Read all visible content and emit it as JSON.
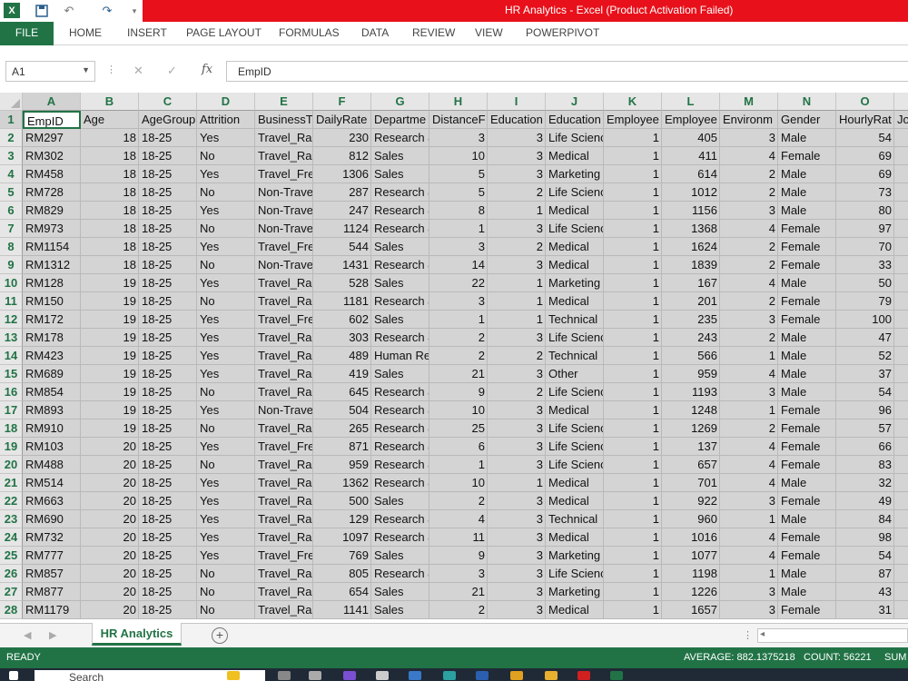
{
  "window": {
    "title": "HR Analytics -  Excel (Product Activation Failed)"
  },
  "qat": {
    "undo_glyph": "↶",
    "redo_glyph": "↷"
  },
  "ribbon": {
    "tabs": [
      "FILE",
      "HOME",
      "INSERT",
      "PAGE LAYOUT",
      "FORMULAS",
      "DATA",
      "REVIEW",
      "VIEW",
      "POWERPIVOT"
    ]
  },
  "formula_bar": {
    "name_box": "A1",
    "fx_label": "fx",
    "content": "EmpID"
  },
  "columns": [
    "A",
    "B",
    "C",
    "D",
    "E",
    "F",
    "G",
    "H",
    "I",
    "J",
    "K",
    "L",
    "M",
    "N",
    "O"
  ],
  "headers": [
    "EmpID",
    "Age",
    "AgeGroup",
    "Attrition",
    "BusinessT",
    "DailyRate",
    "Departme",
    "DistanceF",
    "Education",
    "Education",
    "Employee",
    "Employee",
    "Environm",
    "Gender",
    "HourlyRat",
    "Jo"
  ],
  "rows": [
    [
      "RM297",
      "18",
      "18-25",
      "Yes",
      "Travel_Ra",
      "230",
      "Research &",
      "3",
      "3",
      "Life Scienc",
      "1",
      "405",
      "3",
      "Male",
      "54"
    ],
    [
      "RM302",
      "18",
      "18-25",
      "No",
      "Travel_Ra",
      "812",
      "Sales",
      "10",
      "3",
      "Medical",
      "1",
      "411",
      "4",
      "Female",
      "69"
    ],
    [
      "RM458",
      "18",
      "18-25",
      "Yes",
      "Travel_Fre",
      "1306",
      "Sales",
      "5",
      "3",
      "Marketing",
      "1",
      "614",
      "2",
      "Male",
      "69"
    ],
    [
      "RM728",
      "18",
      "18-25",
      "No",
      "Non-Trave",
      "287",
      "Research &",
      "5",
      "2",
      "Life Scienc",
      "1",
      "1012",
      "2",
      "Male",
      "73"
    ],
    [
      "RM829",
      "18",
      "18-25",
      "Yes",
      "Non-Trave",
      "247",
      "Research &",
      "8",
      "1",
      "Medical",
      "1",
      "1156",
      "3",
      "Male",
      "80"
    ],
    [
      "RM973",
      "18",
      "18-25",
      "No",
      "Non-Trave",
      "1124",
      "Research &",
      "1",
      "3",
      "Life Scienc",
      "1",
      "1368",
      "4",
      "Female",
      "97"
    ],
    [
      "RM1154",
      "18",
      "18-25",
      "Yes",
      "Travel_Fre",
      "544",
      "Sales",
      "3",
      "2",
      "Medical",
      "1",
      "1624",
      "2",
      "Female",
      "70"
    ],
    [
      "RM1312",
      "18",
      "18-25",
      "No",
      "Non-Trave",
      "1431",
      "Research &",
      "14",
      "3",
      "Medical",
      "1",
      "1839",
      "2",
      "Female",
      "33"
    ],
    [
      "RM128",
      "19",
      "18-25",
      "Yes",
      "Travel_Ra",
      "528",
      "Sales",
      "22",
      "1",
      "Marketing",
      "1",
      "167",
      "4",
      "Male",
      "50"
    ],
    [
      "RM150",
      "19",
      "18-25",
      "No",
      "Travel_Ra",
      "1181",
      "Research &",
      "3",
      "1",
      "Medical",
      "1",
      "201",
      "2",
      "Female",
      "79"
    ],
    [
      "RM172",
      "19",
      "18-25",
      "Yes",
      "Travel_Fre",
      "602",
      "Sales",
      "1",
      "1",
      "Technical",
      "1",
      "235",
      "3",
      "Female",
      "100"
    ],
    [
      "RM178",
      "19",
      "18-25",
      "Yes",
      "Travel_Ra",
      "303",
      "Research &",
      "2",
      "3",
      "Life Scienc",
      "1",
      "243",
      "2",
      "Male",
      "47"
    ],
    [
      "RM423",
      "19",
      "18-25",
      "Yes",
      "Travel_Ra",
      "489",
      "Human Re",
      "2",
      "2",
      "Technical",
      "1",
      "566",
      "1",
      "Male",
      "52"
    ],
    [
      "RM689",
      "19",
      "18-25",
      "Yes",
      "Travel_Ra",
      "419",
      "Sales",
      "21",
      "3",
      "Other",
      "1",
      "959",
      "4",
      "Male",
      "37"
    ],
    [
      "RM854",
      "19",
      "18-25",
      "No",
      "Travel_Ra",
      "645",
      "Research &",
      "9",
      "2",
      "Life Scienc",
      "1",
      "1193",
      "3",
      "Male",
      "54"
    ],
    [
      "RM893",
      "19",
      "18-25",
      "Yes",
      "Non-Trave",
      "504",
      "Research &",
      "10",
      "3",
      "Medical",
      "1",
      "1248",
      "1",
      "Female",
      "96"
    ],
    [
      "RM910",
      "19",
      "18-25",
      "No",
      "Travel_Ra",
      "265",
      "Research &",
      "25",
      "3",
      "Life Scienc",
      "1",
      "1269",
      "2",
      "Female",
      "57"
    ],
    [
      "RM103",
      "20",
      "18-25",
      "Yes",
      "Travel_Fre",
      "871",
      "Research &",
      "6",
      "3",
      "Life Scienc",
      "1",
      "137",
      "4",
      "Female",
      "66"
    ],
    [
      "RM488",
      "20",
      "18-25",
      "No",
      "Travel_Ra",
      "959",
      "Research &",
      "1",
      "3",
      "Life Scienc",
      "1",
      "657",
      "4",
      "Female",
      "83"
    ],
    [
      "RM514",
      "20",
      "18-25",
      "Yes",
      "Travel_Ra",
      "1362",
      "Research &",
      "10",
      "1",
      "Medical",
      "1",
      "701",
      "4",
      "Male",
      "32"
    ],
    [
      "RM663",
      "20",
      "18-25",
      "Yes",
      "Travel_Ra",
      "500",
      "Sales",
      "2",
      "3",
      "Medical",
      "1",
      "922",
      "3",
      "Female",
      "49"
    ],
    [
      "RM690",
      "20",
      "18-25",
      "Yes",
      "Travel_Ra",
      "129",
      "Research &",
      "4",
      "3",
      "Technical",
      "1",
      "960",
      "1",
      "Male",
      "84"
    ],
    [
      "RM732",
      "20",
      "18-25",
      "Yes",
      "Travel_Ra",
      "1097",
      "Research &",
      "11",
      "3",
      "Medical",
      "1",
      "1016",
      "4",
      "Female",
      "98"
    ],
    [
      "RM777",
      "20",
      "18-25",
      "Yes",
      "Travel_Fre",
      "769",
      "Sales",
      "9",
      "3",
      "Marketing",
      "1",
      "1077",
      "4",
      "Female",
      "54"
    ],
    [
      "RM857",
      "20",
      "18-25",
      "No",
      "Travel_Ra",
      "805",
      "Research &",
      "3",
      "3",
      "Life Scienc",
      "1",
      "1198",
      "1",
      "Male",
      "87"
    ],
    [
      "RM877",
      "20",
      "18-25",
      "No",
      "Travel_Ra",
      "654",
      "Sales",
      "21",
      "3",
      "Marketing",
      "1",
      "1226",
      "3",
      "Male",
      "43"
    ],
    [
      "RM1179",
      "20",
      "18-25",
      "No",
      "Travel_Ra",
      "1141",
      "Sales",
      "2",
      "3",
      "Medical",
      "1",
      "1657",
      "3",
      "Female",
      "31"
    ]
  ],
  "sheet_tabs": {
    "active": "HR Analytics",
    "add_glyph": "+"
  },
  "status": {
    "ready": "READY",
    "average": "AVERAGE: 882.1375218",
    "count": "COUNT: 56221",
    "sum": "SUM"
  },
  "taskbar": {
    "search_placeholder": "Search"
  }
}
